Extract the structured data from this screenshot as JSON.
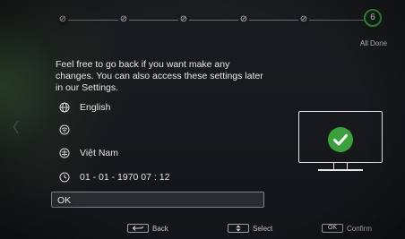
{
  "stepper": {
    "completed_steps": [
      {
        "icon": "check-circle-icon",
        "symbol": "⊘"
      },
      {
        "icon": "check-circle-icon",
        "symbol": "⊘"
      },
      {
        "icon": "check-circle-icon",
        "symbol": "⊘"
      },
      {
        "icon": "check-circle-icon",
        "symbol": "⊘"
      },
      {
        "icon": "check-circle-icon",
        "symbol": "⊘"
      }
    ],
    "active_step_number": "6",
    "active_step_label": "All Done",
    "active_color": "#3aa13c"
  },
  "message": "Feel free to go back if you want make any changes. You can also access these settings later in our Settings.",
  "summary": {
    "language": {
      "icon": "globe-icon",
      "value": "English"
    },
    "network": {
      "icon": "wifi-icon",
      "value": ""
    },
    "country": {
      "icon": "location-icon",
      "value": "Việt Nam"
    },
    "datetime": {
      "icon": "clock-icon",
      "value": "01 - 01 - 1970 07 : 12"
    }
  },
  "ok_button": {
    "label": "OK"
  },
  "illustration": {
    "icon": "monitor-check-icon",
    "check_color": "#3aa13c"
  },
  "hints": {
    "back": {
      "key_icon": "back-arrow-icon",
      "label": "Back"
    },
    "select": {
      "key_icon": "up-down-icon",
      "label": "Select"
    },
    "confirm": {
      "key_label": "OK",
      "label": "Confirm"
    }
  }
}
